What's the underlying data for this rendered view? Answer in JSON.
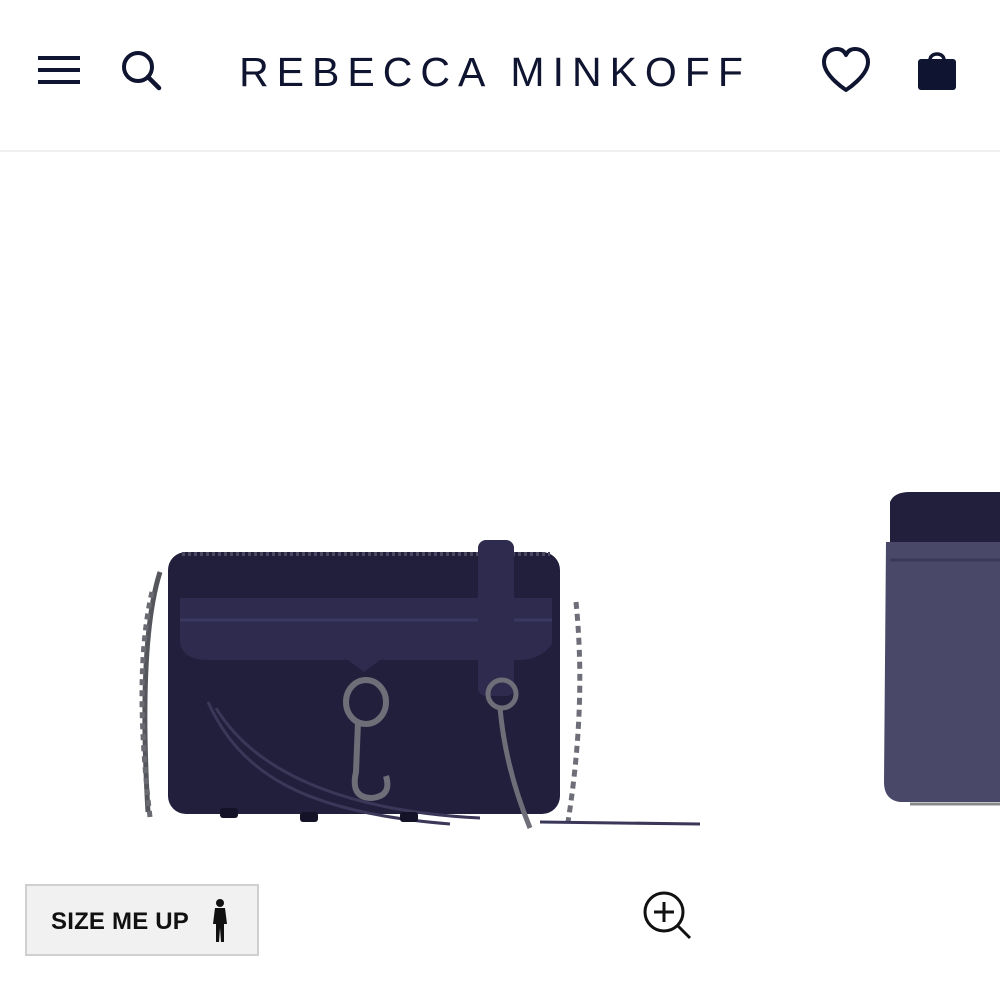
{
  "header": {
    "brand": "REBECCA MINKOFF",
    "icons": {
      "menu": "hamburger-menu-icon",
      "search": "search-icon",
      "wishlist": "heart-icon",
      "bag": "shopping-bag-icon"
    }
  },
  "gallery": {
    "size_button": {
      "label": "SIZE ME UP",
      "icon": "person-silhouette-icon"
    },
    "zoom_icon": "zoom-in-icon"
  },
  "colors": {
    "brand_navy": "#0f1530",
    "product_suede": "#221f3c",
    "product_leather": "#2e2b4f",
    "product_peek": "#4a4868",
    "header_border": "#efefef",
    "button_bg": "#f1f1f1"
  }
}
